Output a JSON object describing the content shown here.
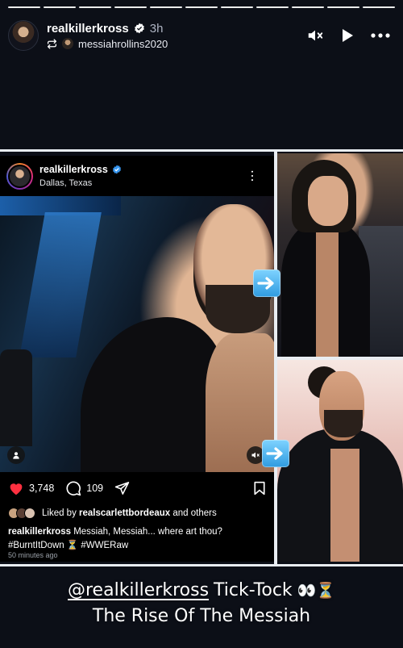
{
  "story": {
    "progress_segments": 11,
    "author": "realkillerkross",
    "time": "3h",
    "reposted_from": "messiahrollins2020",
    "icons": [
      "verified-badge-icon",
      "repost-icon",
      "mute-icon",
      "play-icon",
      "more-icon"
    ]
  },
  "post": {
    "username": "realkillerkross",
    "location": "Dallas, Texas",
    "likes": "3,748",
    "comments": "109",
    "liked_by_prefix": "Liked by ",
    "liked_by_user": "realscarlettbordeaux",
    "liked_by_suffix": " and others",
    "caption_user": "realkillerkross",
    "caption_text": " Messiah, Messiah... where art thou?",
    "hashtags": "#BurntItDown ⏳ #WWERaw",
    "posted_time": "50 minutes ago"
  },
  "caption": {
    "mention": "@realkillerkross",
    "line1_rest": " Tick-Tock ",
    "emoji": "👀⏳",
    "line2": "The Rise Of The Messiah"
  },
  "colors": {
    "background": "#0c0f17",
    "verified": "#3897f0",
    "like_red": "#ff3040",
    "arrow_blue": "#3aa4e6"
  }
}
